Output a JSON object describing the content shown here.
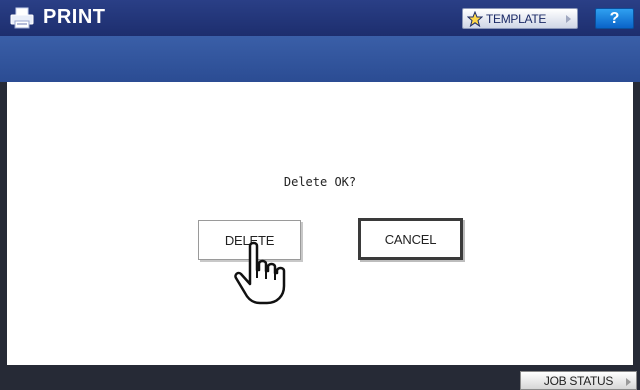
{
  "header": {
    "title": "PRINT",
    "icon": "printer-icon",
    "template_label": "TEMPLATE",
    "template_icon": "star-icon",
    "help_label": "?"
  },
  "dialog": {
    "message": "Delete OK?",
    "delete_label": "DELETE",
    "cancel_label": "CANCEL",
    "pointer_icon": "hand-pointer-icon"
  },
  "footer": {
    "job_status_label": "JOB STATUS"
  },
  "colors": {
    "title_bar": "#1d2e6e",
    "blue_band": "#3a5fa8",
    "help_button": "#1b84dd",
    "frame": "#262a36"
  }
}
